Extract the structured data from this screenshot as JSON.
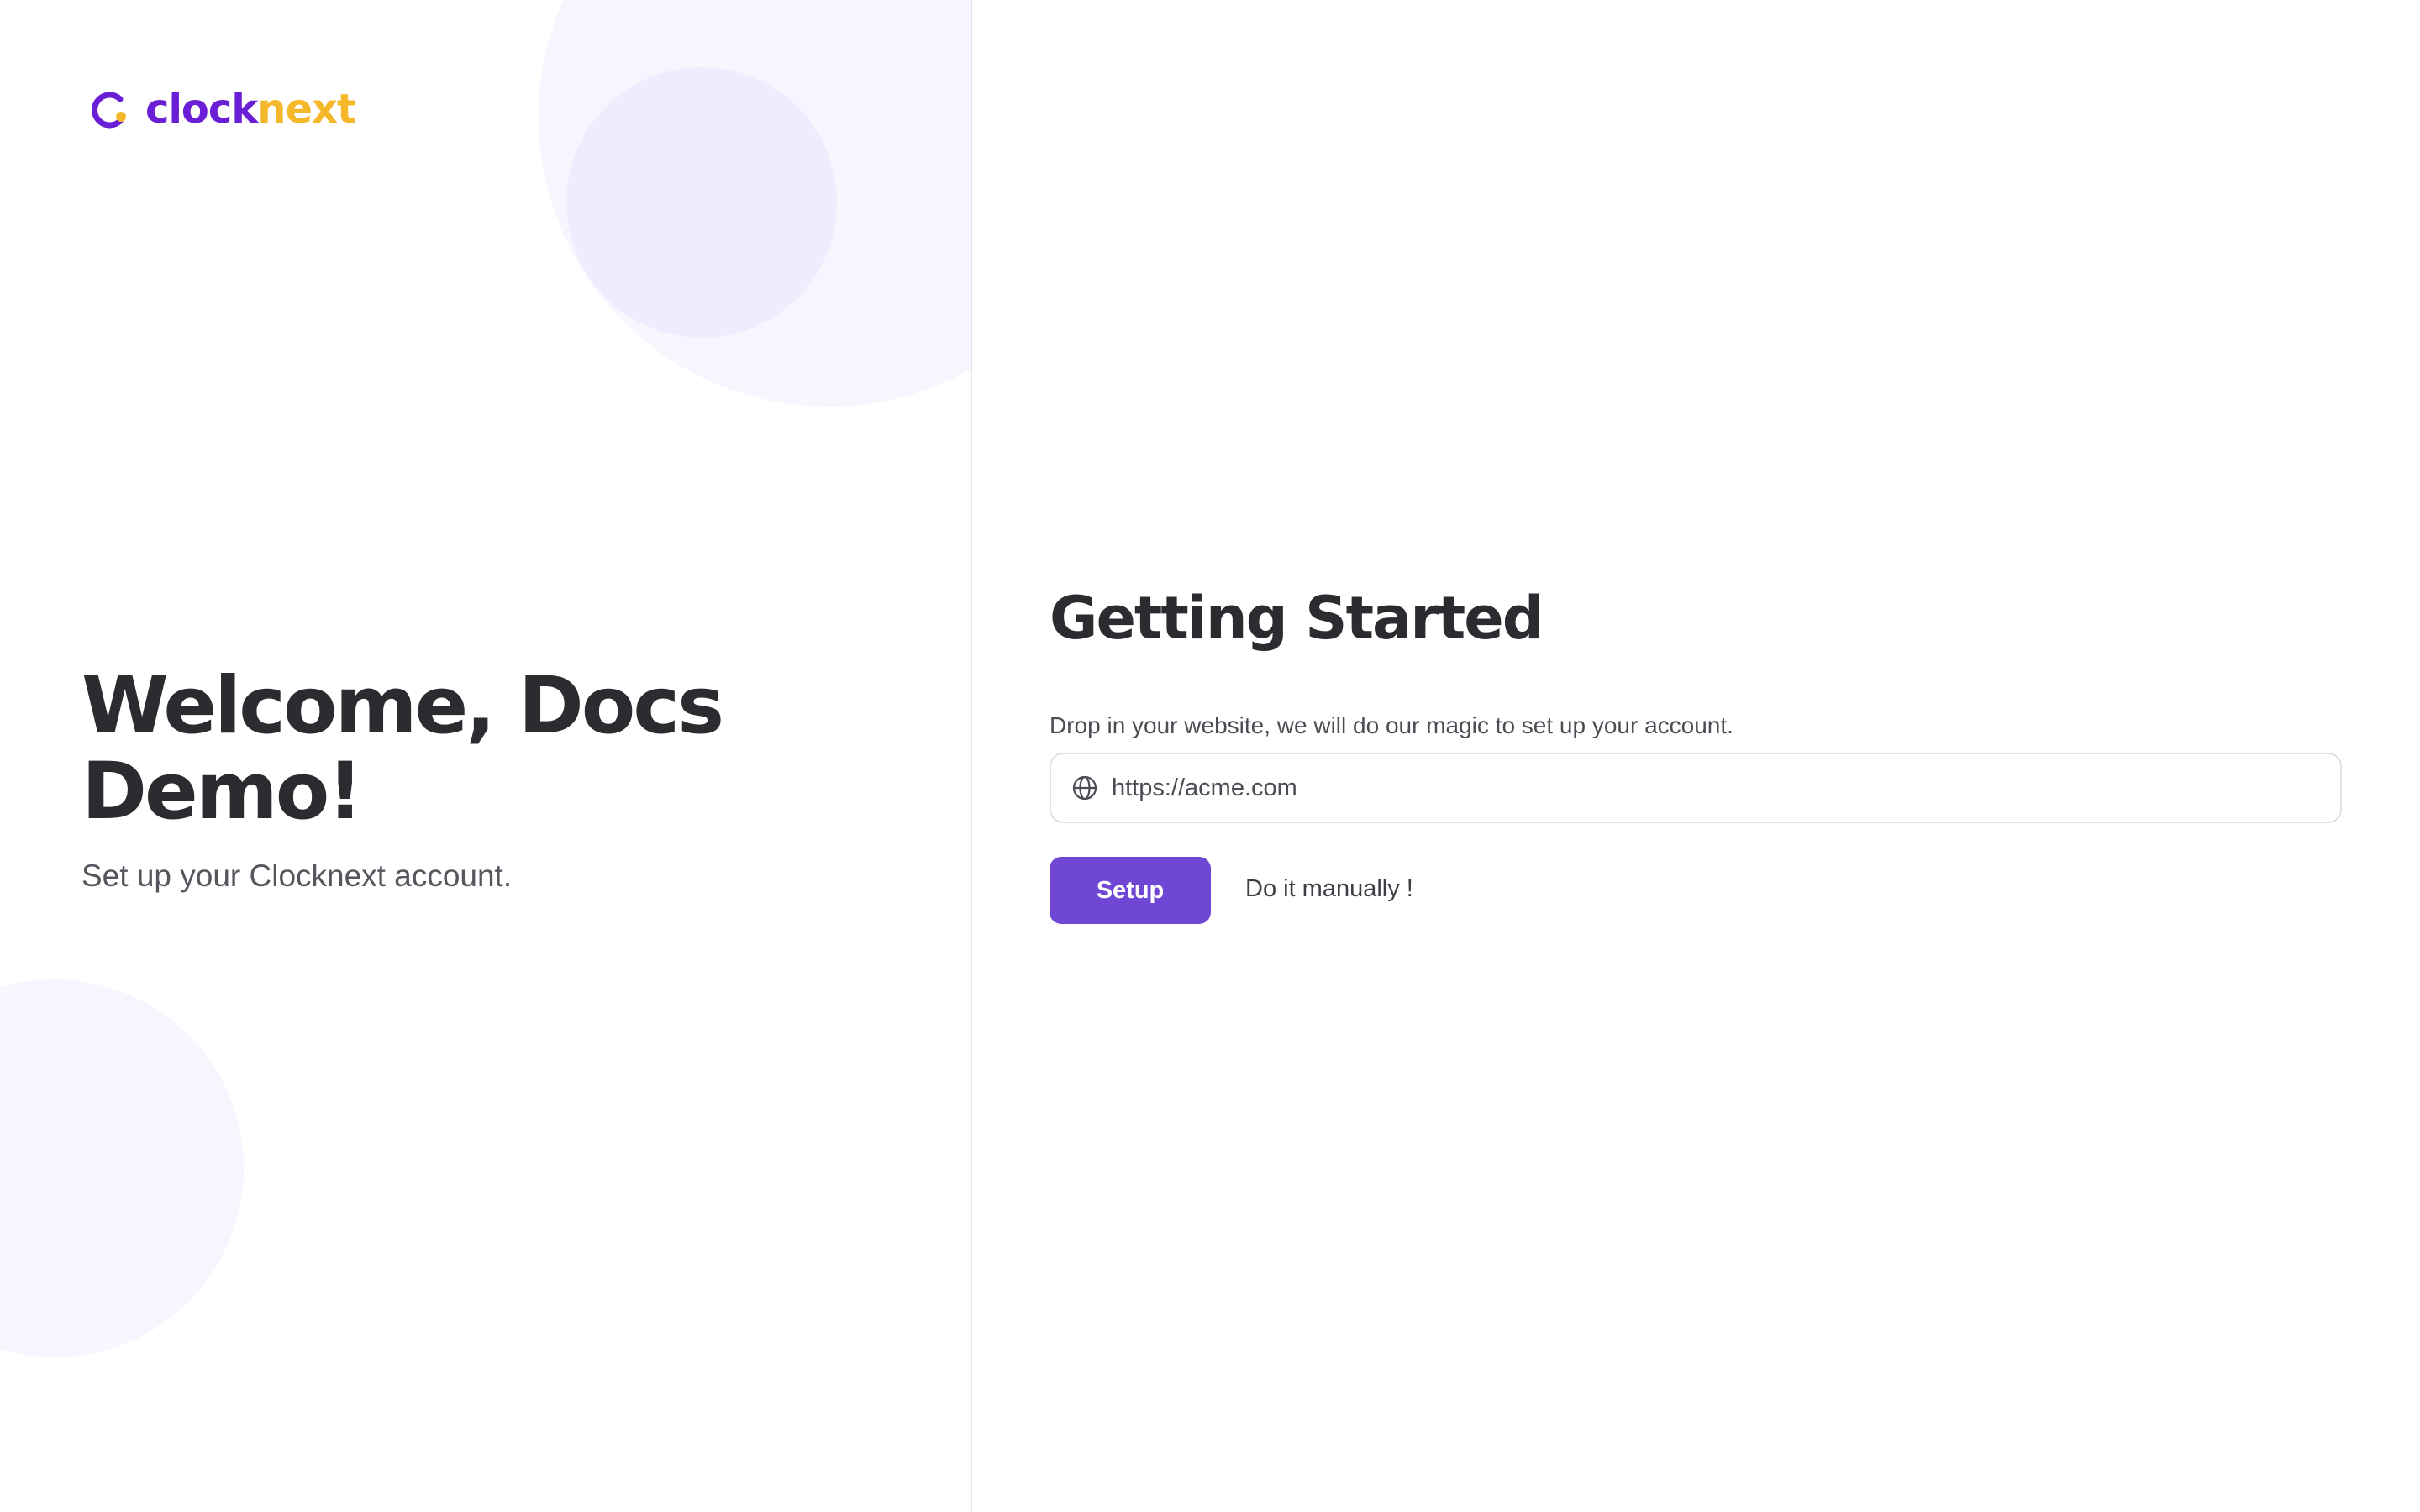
{
  "logo": {
    "part1": "clock",
    "part2": "next",
    "icon": "clocknext-logo-icon",
    "colors": {
      "primary": "#6a1fd6",
      "secondary": "#f5b82a"
    }
  },
  "welcome": {
    "heading": "Welcome, Docs Demo!",
    "subtitle": "Set up your Clocknext account."
  },
  "getting_started": {
    "title": "Getting Started",
    "description": "Drop in your website, we will do our magic to set up your account.",
    "website_input": {
      "icon": "globe-icon",
      "value": "",
      "placeholder": "https://acme.com"
    },
    "setup_label": "Setup",
    "manual_label": "Do it manually !"
  },
  "colors": {
    "accent": "#7047d5",
    "blob_light": "#f7f5fe",
    "blob_mid": "#efedfd"
  }
}
